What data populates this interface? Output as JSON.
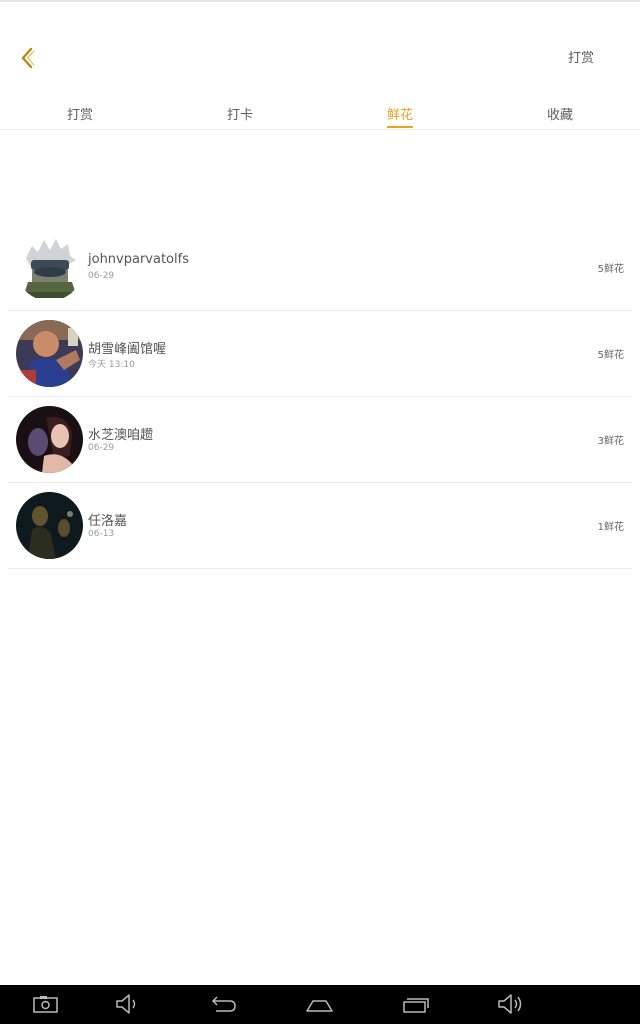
{
  "header": {
    "reward_label": "打赏"
  },
  "tabs": [
    {
      "label": "打赏",
      "active": false
    },
    {
      "label": "打卡",
      "active": false
    },
    {
      "label": "鲜花",
      "active": true
    },
    {
      "label": "收藏",
      "active": false
    }
  ],
  "list": [
    {
      "name": "johnvparvatolfs",
      "date": "06-29",
      "amount": "5鲜花"
    },
    {
      "name": "胡雪峰阖馆喔",
      "date": "今天 13:10",
      "amount": "5鲜花"
    },
    {
      "name": "水芝澳咱趱",
      "date": "06-29",
      "amount": "3鲜花"
    },
    {
      "name": "任洛嘉",
      "date": "06-13",
      "amount": "1鲜花"
    }
  ],
  "colors": {
    "accent": "#f0a020",
    "divider": "#ececec",
    "navbar": "#000000"
  },
  "icons": {
    "back": "chevron-left-icon",
    "nav": [
      "screenshot-icon",
      "volume-down-icon",
      "back-arrow-icon",
      "home-icon",
      "recent-apps-icon",
      "volume-up-icon"
    ]
  }
}
